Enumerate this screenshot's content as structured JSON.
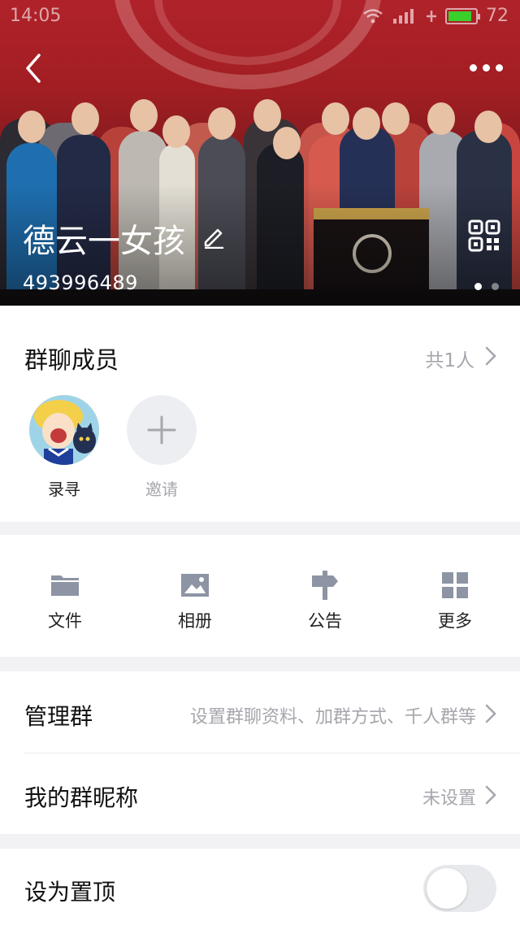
{
  "status_bar": {
    "time": "14:05",
    "battery": "72"
  },
  "header": {
    "group_name": "德云一女孩",
    "group_id": "493996489",
    "carousel": {
      "page_count": 2,
      "active_page": 1
    }
  },
  "members": {
    "title": "群聊成员",
    "count_label": "共1人",
    "list": [
      {
        "name": "录寻"
      }
    ],
    "invite_label": "邀请"
  },
  "tools": [
    {
      "label": "文件",
      "icon": "folder-icon"
    },
    {
      "label": "相册",
      "icon": "photo-icon"
    },
    {
      "label": "公告",
      "icon": "signpost-icon"
    },
    {
      "label": "更多",
      "icon": "grid-icon"
    }
  ],
  "settings": {
    "manage": {
      "title": "管理群",
      "value": "设置群聊资料、加群方式、千人群等"
    },
    "nickname": {
      "title": "我的群昵称",
      "value": "未设置"
    },
    "pin": {
      "title": "设为置顶",
      "enabled": false
    }
  },
  "colors": {
    "accent_green": "#39d02c",
    "muted_text": "#a6a6ad",
    "icon_gray": "#8d94a3"
  }
}
